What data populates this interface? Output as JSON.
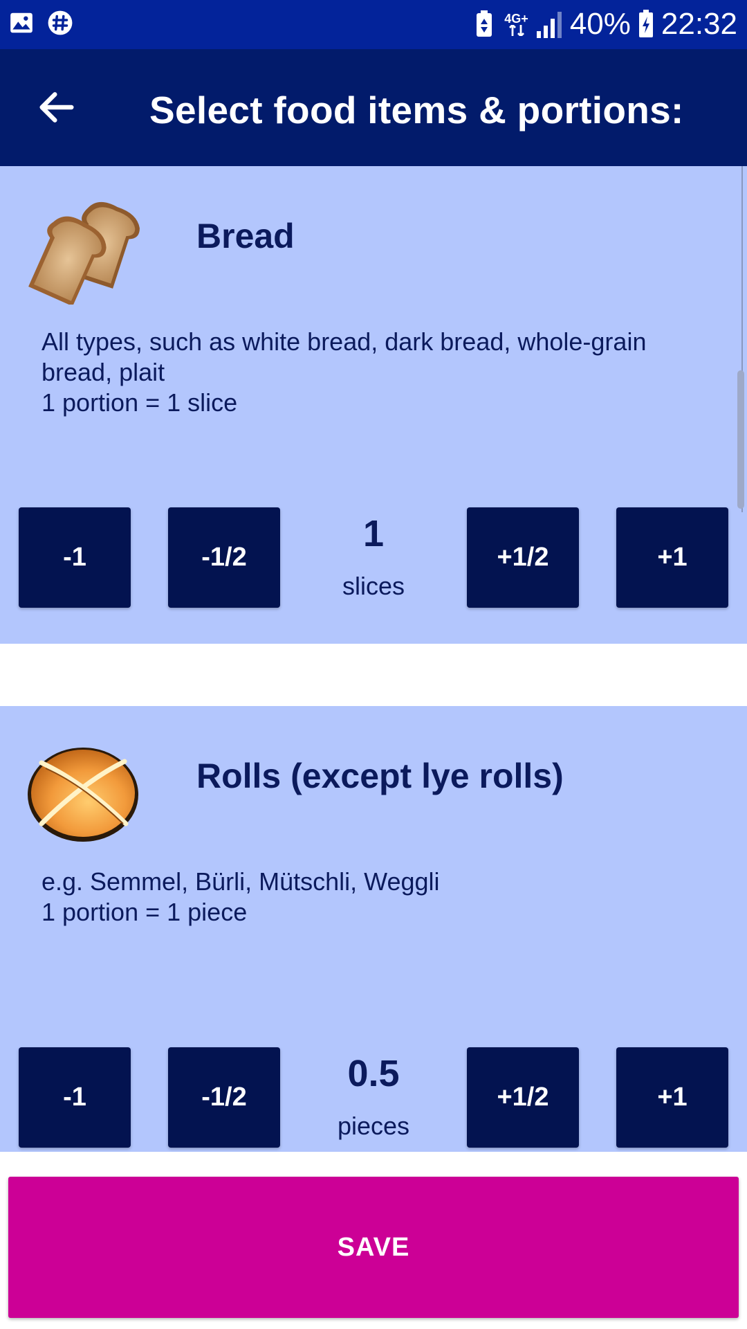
{
  "status_bar": {
    "battery": "40%",
    "time": "22:32",
    "network": "4G+",
    "icons": [
      "gallery-icon",
      "slack-icon",
      "battery-saver-icon",
      "network-icon",
      "signal-icon",
      "battery-icon"
    ]
  },
  "app_bar": {
    "title": "Select food items & portions:",
    "back_icon": "arrow-left-icon"
  },
  "colors": {
    "status_bar": "#03239a",
    "app_bar": "#021b6b",
    "card_bg": "#b3c6fd",
    "button_bg": "#031350",
    "save_bg": "#cc0096"
  },
  "items": [
    {
      "title": "Bread",
      "icon": "bread-icon",
      "desc_line1": "All types, such as white bread, dark bread, whole-grain bread, plait",
      "desc_line2": "1 portion = 1 slice",
      "amount": "1",
      "unit": "slices",
      "buttons": [
        "-1",
        "-1/2",
        "+1/2",
        "+1"
      ]
    },
    {
      "title": "Rolls (except lye rolls)",
      "icon": "roll-icon",
      "desc_line1": "e.g. Semmel, Bürli, Mütschli, Weggli",
      "desc_line2": "1 portion = 1 piece",
      "amount": "0.5",
      "unit": "pieces",
      "buttons": [
        "-1",
        "-1/2",
        "+1/2",
        "+1"
      ]
    }
  ],
  "save_label": "SAVE"
}
